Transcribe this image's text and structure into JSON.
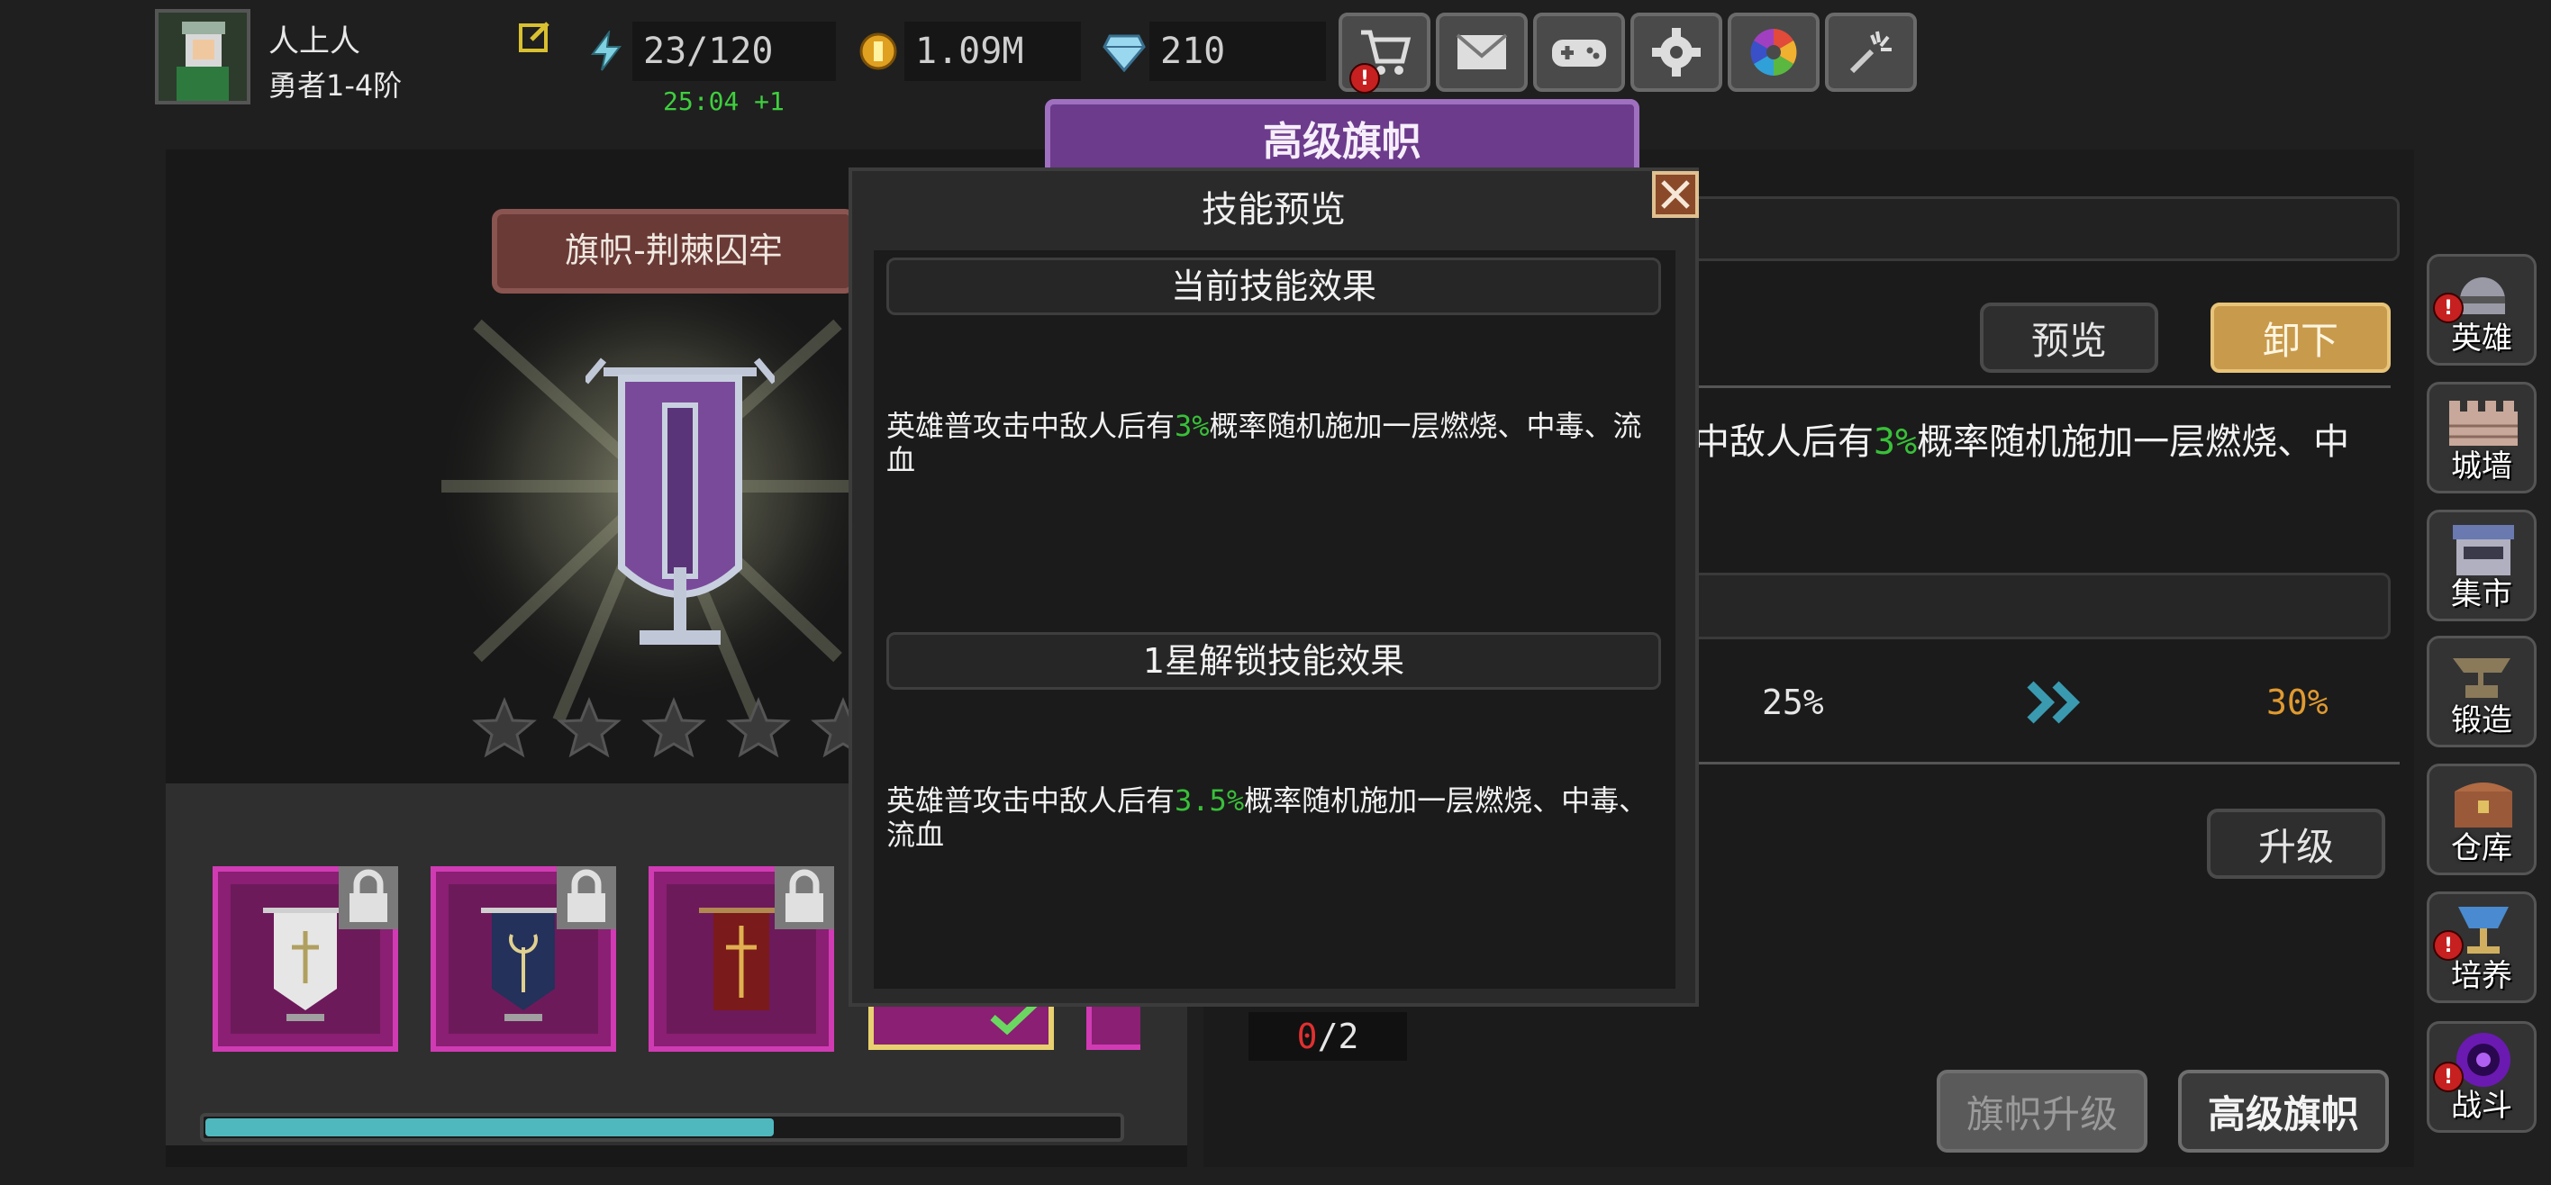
{
  "player": {
    "name": "人上人",
    "rank": "勇者1-4阶"
  },
  "resources": {
    "energy": "23/120",
    "energy_timer": "25:04 +1",
    "gold": "1.09M",
    "gems": "210"
  },
  "top_buttons": [
    {
      "icon": "shopping-cart-icon",
      "badge": "!"
    },
    {
      "icon": "mail-icon"
    },
    {
      "icon": "gamepad-icon"
    },
    {
      "icon": "gear-icon"
    },
    {
      "icon": "color-wheel-icon"
    },
    {
      "icon": "fireworks-icon"
    }
  ],
  "left": {
    "banner_title": "旗帜-荆棘囚牢",
    "stars_total": 5,
    "stars_filled": 0,
    "progress": 0.62
  },
  "right": {
    "header_title": "高级旗帜",
    "preview_button": "预览",
    "unequip_button": "卸下",
    "skill_text_pre": "中敌人后有",
    "skill_text_pct": "3%",
    "skill_text_post": "概率随机施加一层燃烧、中",
    "stat_from": "25%",
    "stat_to": "30%",
    "upgrade_button": "升级",
    "materials_have": "0",
    "materials_need": "/2",
    "tab_banner_upgrade": "旗帜升级",
    "tab_advanced_banner": "高级旗帜"
  },
  "side_nav": [
    {
      "label": "英雄",
      "badge": "!"
    },
    {
      "label": "城墙"
    },
    {
      "label": "集市"
    },
    {
      "label": "锻造"
    },
    {
      "label": "仓库"
    },
    {
      "label": "培养",
      "badge": "!"
    },
    {
      "label": "战斗",
      "badge": "!"
    }
  ],
  "modal": {
    "title": "技能预览",
    "current_head": "当前技能效果",
    "current_pre": "英雄普攻击中敌人后有",
    "current_pct": "3%",
    "current_post": "概率随机施加一层燃烧、中毒、流血",
    "unlock_head": "1星解锁技能效果",
    "unlock_pre": "英雄普攻击中敌人后有",
    "unlock_pct": "3.5%",
    "unlock_post": "概率随机施加一层燃烧、中毒、流血"
  },
  "colors": {
    "accent_gold": "#d6a24a",
    "card_magenta": "#8a1f73",
    "green_text": "#39c039",
    "red_text": "#e03030",
    "progress_teal": "#4fb8bf",
    "header_purple": "#6c3b8c"
  }
}
